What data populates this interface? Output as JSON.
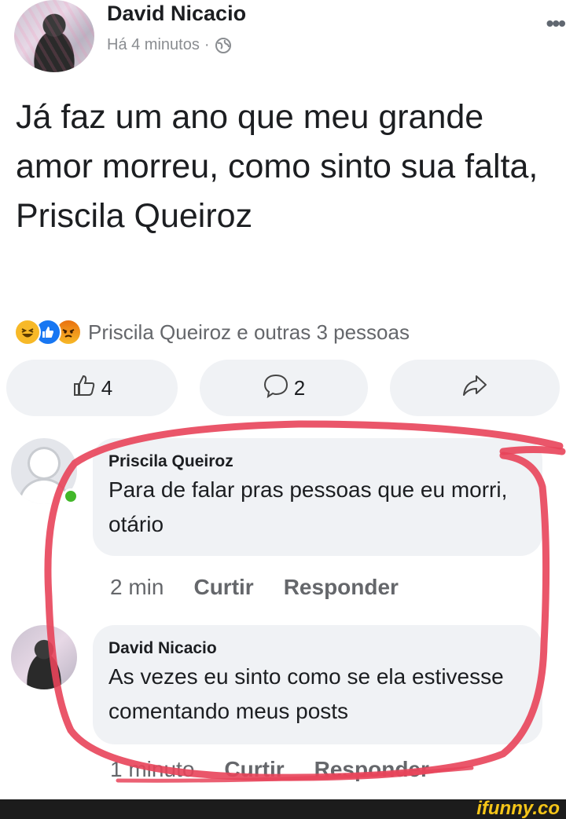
{
  "post": {
    "author": "David Nicacio",
    "time": "Há 4 minutos",
    "separator": "·",
    "text": "Já faz um ano que meu grande amor morreu, como sinto sua falta, Priscila Queiroz",
    "reactions_text": "Priscila Queiroz e outras 3 pessoas",
    "like_count": "4",
    "comment_count": "2"
  },
  "comments": [
    {
      "author": "Priscila Queiroz",
      "text": "Para de falar pras pessoas que eu morri, otário",
      "time": "2 min",
      "like_label": "Curtir",
      "reply_label": "Responder"
    },
    {
      "author": "David Nicacio",
      "text": "As vezes eu sinto como se ela estivesse comentando meus posts",
      "time": "1 minuto",
      "like_label": "Curtir",
      "reply_label": "Responder"
    }
  ],
  "watermark": "ifunny.co",
  "icons": {
    "more": "more-icon",
    "globe": "globe-icon",
    "like": "thumbs-up-icon",
    "comment": "comment-icon",
    "share": "share-icon"
  },
  "colors": {
    "annotation": "#e8445a",
    "link_blue": "#1877f2"
  }
}
